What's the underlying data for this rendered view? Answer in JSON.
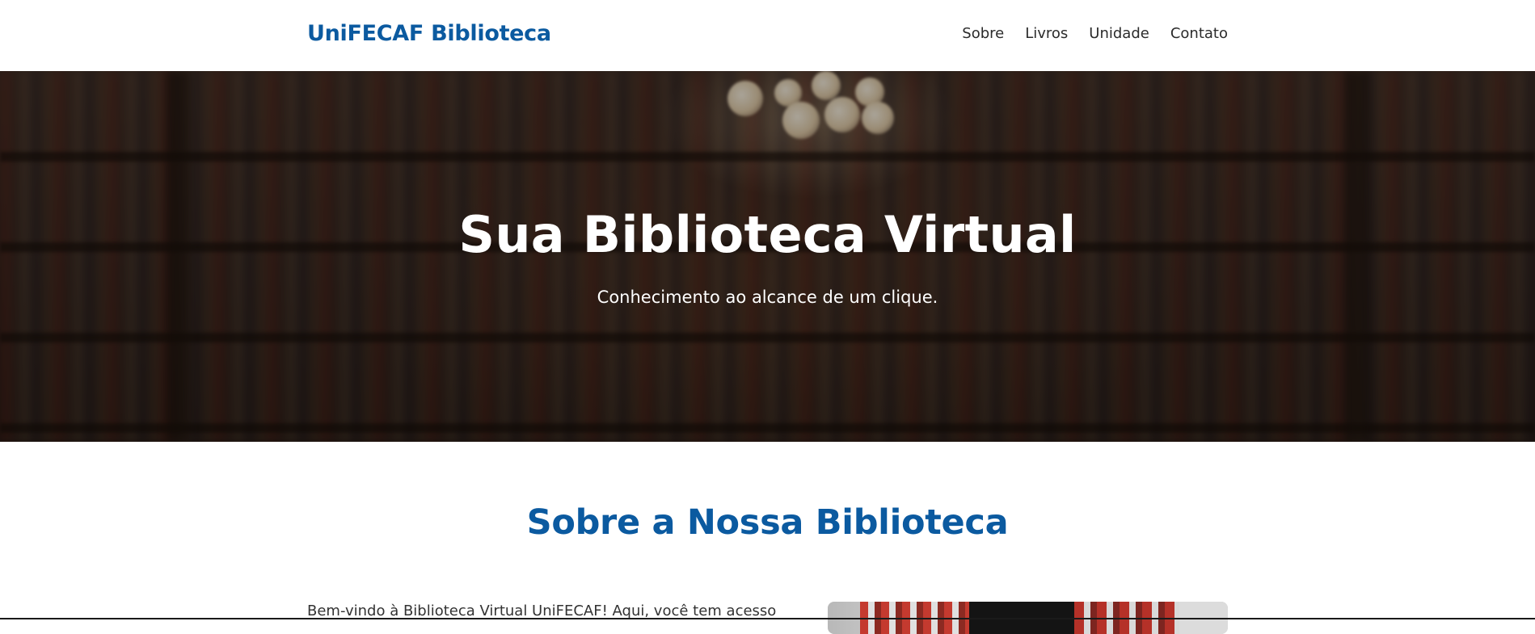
{
  "header": {
    "brand": "UniFECAF Biblioteca",
    "nav": [
      {
        "label": "Sobre"
      },
      {
        "label": "Livros"
      },
      {
        "label": "Unidade"
      },
      {
        "label": "Contato"
      }
    ]
  },
  "hero": {
    "title": "Sua Biblioteca Virtual",
    "subtitle": "Conhecimento ao alcance de um clique."
  },
  "about": {
    "title": "Sobre a Nossa Biblioteca",
    "text": "Bem-vindo à Biblioteca Virtual UniFECAF! Aqui, você tem acesso"
  },
  "colors": {
    "brand": "#0b5aa0",
    "nav_text": "#2b2b2b",
    "hero_text": "#ffffff",
    "body_text": "#333333"
  }
}
